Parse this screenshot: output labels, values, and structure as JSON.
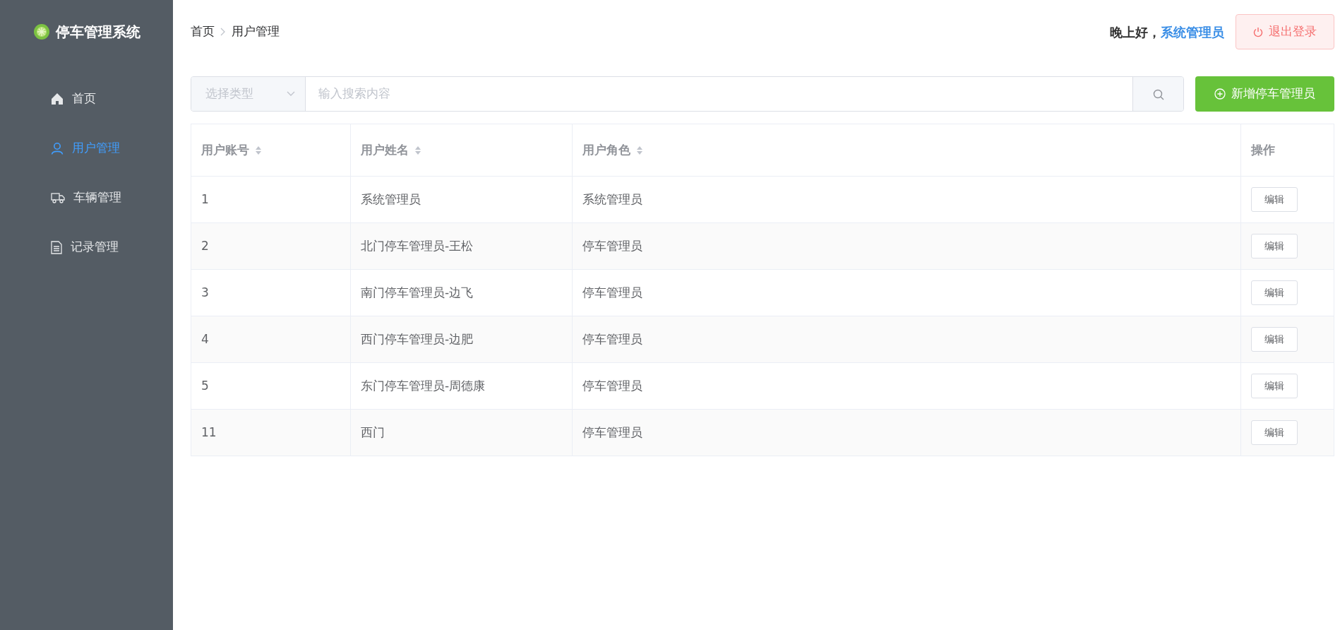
{
  "sidebar": {
    "title": "停车管理系统",
    "items": [
      {
        "label": "首页",
        "kind": "home",
        "selected": false
      },
      {
        "label": "用户管理",
        "kind": "user",
        "selected": true
      },
      {
        "label": "车辆管理",
        "kind": "truck",
        "selected": false
      },
      {
        "label": "记录管理",
        "kind": "document",
        "selected": false
      }
    ]
  },
  "breadcrumb": [
    "首页",
    "用户管理"
  ],
  "header": {
    "greeting": "晚上好，",
    "user": "系统管理员",
    "logout": "退出登录"
  },
  "search": {
    "type_placeholder": "选择类型",
    "placeholder": "输入搜索内容"
  },
  "add_button": "新增停车管理员",
  "table": {
    "columns": [
      {
        "label": "用户账号",
        "sortable": true
      },
      {
        "label": "用户姓名",
        "sortable": true
      },
      {
        "label": "用户角色",
        "sortable": true
      },
      {
        "label": "操作",
        "sortable": false
      }
    ],
    "rows": [
      {
        "account": "1",
        "name": "系统管理员",
        "role": "系统管理员",
        "action": "编辑"
      },
      {
        "account": "2",
        "name": "北门停车管理员-王松",
        "role": "停车管理员",
        "action": "编辑"
      },
      {
        "account": "3",
        "name": "南门停车管理员-边飞",
        "role": "停车管理员",
        "action": "编辑"
      },
      {
        "account": "4",
        "name": "西门停车管理员-边肥",
        "role": "停车管理员",
        "action": "编辑"
      },
      {
        "account": "5",
        "name": "东门停车管理员-周德康",
        "role": "停车管理员",
        "action": "编辑"
      },
      {
        "account": "11",
        "name": "西门",
        "role": "停车管理员",
        "action": "编辑"
      }
    ]
  }
}
